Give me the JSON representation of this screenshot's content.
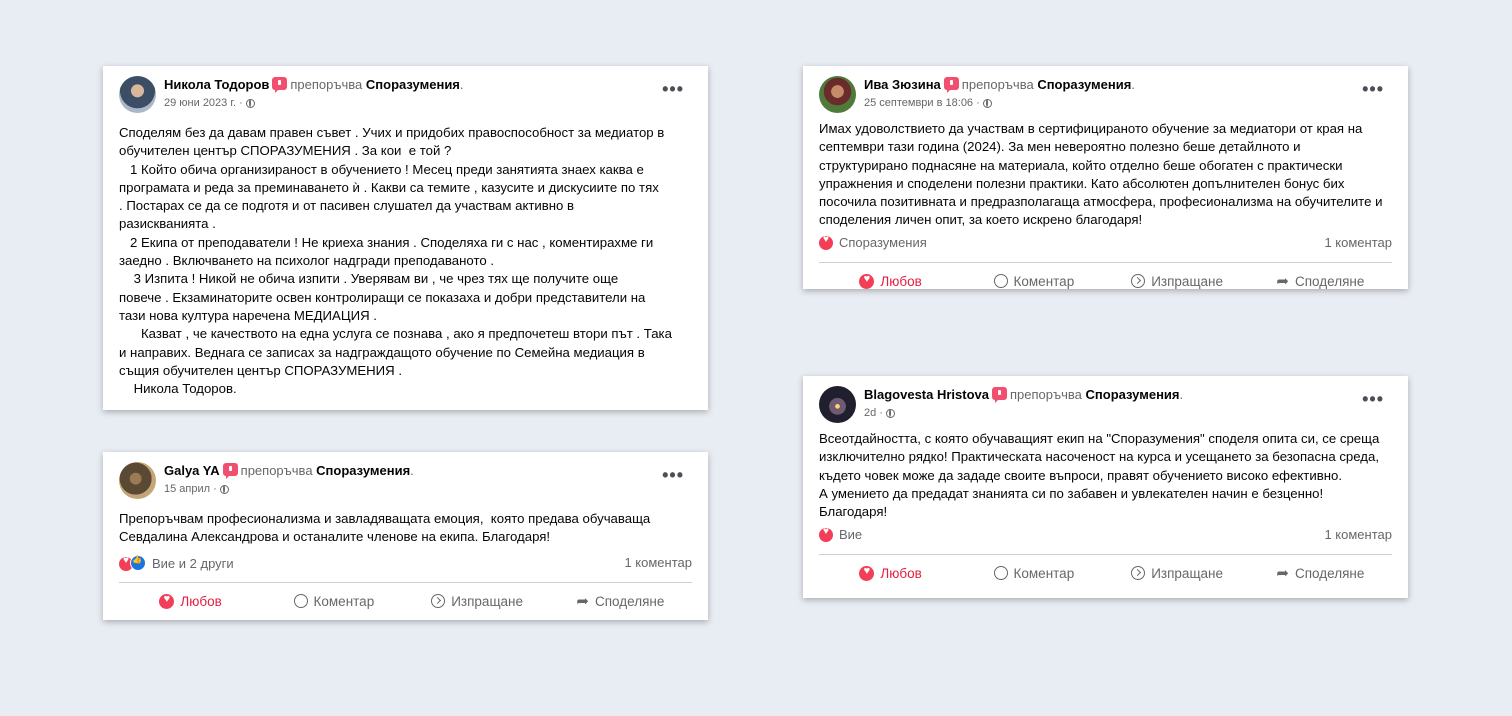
{
  "common": {
    "verb": "препоръчва",
    "page": "Споразумения",
    "dot": ".",
    "more": "•••",
    "actions": {
      "love": "Любов",
      "comment": "Коментар",
      "send": "Изпращане",
      "share": "Споделяне"
    }
  },
  "posts": [
    {
      "author": "Никола Тодоров",
      "date": "29 юни 2023 г. ·",
      "text": "Споделям без да давам правен съвет . Учих и придобих правоспособност за медиатор в\nобучителен център СПОРАЗУМЕНИЯ . За кои  е той ?\n   1 Който обича организираност в обучението ! Месец преди занятията знаех каква е\nпрограмата и реда за преминаването ѝ . Какви са темите , казусите и дискусиите по тях\n. Постарах се да се подготя и от пасивен слушател да участвам активно в\nразискванията .\n   2 Екипа от преподаватели ! Не криеха знания . Споделяха ги с нас , коментирахме ги\nзаедно . Включването на психолог надгради преподаваното .\n    3 Изпита ! Никой не обича изпити . Уверявам ви , че чрез тях ще получите още\nповече . Екзаминаторите освен контролиращи се показаха и добри представители на\nтази нова култура наречена МЕДИАЦИЯ .\n      Казват , че качеството на една услуга се познава , ако я предпочетеш втори път . Така\nи направих. Веднага се записах за надграждащото обучение по Семейна медиация в\nсъщия обучителен център СПОРАЗУМЕНИЯ .\n    Никола Тодоров."
    },
    {
      "author": "Ива Зюзина",
      "date": "25 септември в 18:06 ·",
      "text": "Имах удоволствието да участвам в сертифицираното обучение за медиатори от края на\nсептември тази година (2024). За мен невероятно полезно беше детайлното и\nструктурирано поднасяне на материала, който отделно беше обогатен с практически\nупражнения и споделени полезни практики. Като абсолютен допълнителен бонус бих\nпосочила позитивната и предразполагаща атмосфера, професионализма на обучителите и\nсподеления личен опит, за което искрено благодаря!",
      "reactions": "Споразумения",
      "comments": "1 коментар"
    },
    {
      "author": "Galya YA",
      "date": "15 април ·",
      "text": "Препоръчвам професионализма и завладяващата емоция,  която предава обучаваща\nСевдалина Александрова и останалите членове на екипа. Благодаря!",
      "reactions": "Вие и 2 други",
      "comments": "1 коментар"
    },
    {
      "author": "Blagovesta Hristova",
      "date": "2d ·",
      "text": "Всеотдайността, с която обучаващият екип на \"Споразумения\" споделя опита си, се среща\nизключително рядко! Практическата насоченост на курса и усещането за безопасна среда,\nкъдето човек може да зададе своите въпроси, правят обучението високо ефективно.\nА умението да предадат знанията си по забавен и увлекателен начин е безценно!\nБлагодаря!",
      "reactions": "Вие",
      "comments": "1 коментар"
    }
  ]
}
